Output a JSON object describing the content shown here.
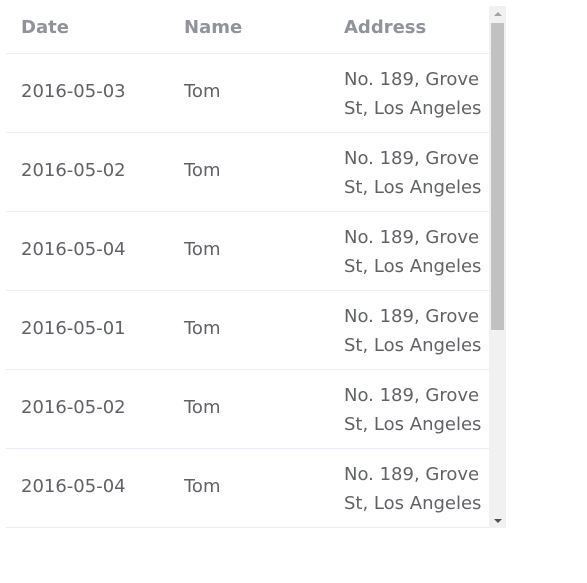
{
  "table": {
    "columns": {
      "date": "Date",
      "name": "Name",
      "address": "Address"
    },
    "rows": [
      {
        "date": "2016-05-03",
        "name": "Tom",
        "address": "No. 189, Grove St, Los Angeles"
      },
      {
        "date": "2016-05-02",
        "name": "Tom",
        "address": "No. 189, Grove St, Los Angeles"
      },
      {
        "date": "2016-05-04",
        "name": "Tom",
        "address": "No. 189, Grove St, Los Angeles"
      },
      {
        "date": "2016-05-01",
        "name": "Tom",
        "address": "No. 189, Grove St, Los Angeles"
      },
      {
        "date": "2016-05-02",
        "name": "Tom",
        "address": "No. 189, Grove St, Los Angeles"
      },
      {
        "date": "2016-05-04",
        "name": "Tom",
        "address": "No. 189, Grove St, Los Angeles"
      }
    ]
  },
  "scrollbar": {
    "up_icon": "triangle-up-icon",
    "down_icon": "triangle-down-icon"
  },
  "colors": {
    "header_text": "#909399",
    "cell_text": "#606266",
    "row_border": "#ebeef5",
    "scroll_track": "#f1f1f1",
    "scroll_thumb": "#c1c1c1"
  }
}
